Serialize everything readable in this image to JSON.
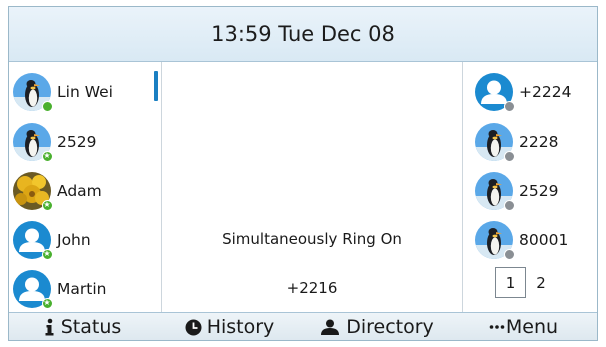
{
  "header": {
    "datetime": "13:59 Tue Dec 08"
  },
  "left_keys": [
    {
      "label": "Lin Wei",
      "avatar": "penguin-photo",
      "status": "green"
    },
    {
      "label": "2529",
      "avatar": "penguin-photo",
      "status": "green-star"
    },
    {
      "label": "Adam",
      "avatar": "flower-photo",
      "status": "green-star"
    },
    {
      "label": "John",
      "avatar": "default-person-icon",
      "status": "green-star"
    },
    {
      "label": "Martin",
      "avatar": "default-person-icon",
      "status": "green-star"
    }
  ],
  "right_keys": [
    {
      "label": "+2224",
      "avatar": "default-person-icon",
      "status": "gray"
    },
    {
      "label": "2228",
      "avatar": "penguin-photo",
      "status": "gray"
    },
    {
      "label": "2529",
      "avatar": "penguin-photo",
      "status": "gray"
    },
    {
      "label": "80001",
      "avatar": "penguin-photo",
      "status": "gray"
    }
  ],
  "center": {
    "status_message": "Simultaneously Ring On",
    "number": "+2216"
  },
  "pager": {
    "current": "1",
    "other": "2"
  },
  "softkeys": [
    {
      "label": "Status",
      "icon": "info-icon"
    },
    {
      "label": "History",
      "icon": "clock-icon"
    },
    {
      "label": "Directory",
      "icon": "contacts-icon"
    },
    {
      "label": "Menu",
      "icon": "ellipsis-icon"
    }
  ],
  "colors": {
    "accent": "#1a7fc2",
    "online": "#49b02e",
    "offline": "#8a8f94",
    "header_bg": "#d9e9f4"
  }
}
